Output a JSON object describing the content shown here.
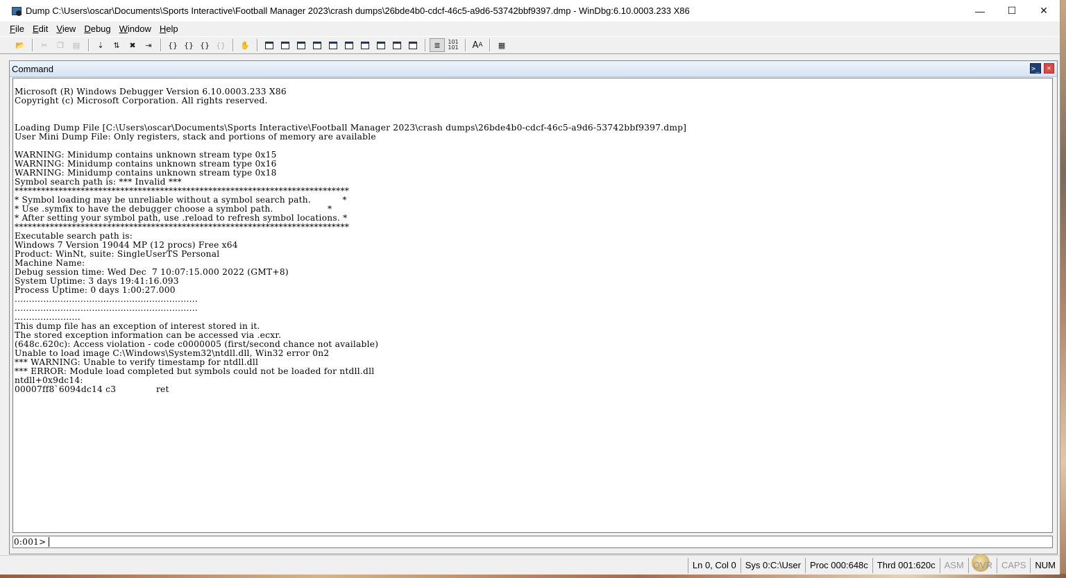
{
  "window": {
    "title": "Dump C:\\Users\\oscar\\Documents\\Sports Interactive\\Football Manager 2023\\crash dumps\\26bde4b0-cdcf-46c5-a9d6-53742bbf9397.dmp - WinDbg:6.10.0003.233 X86",
    "controls": {
      "minimize": "—",
      "maximize": "☐",
      "close": "✕"
    }
  },
  "menu": [
    {
      "label": "File",
      "key": "F",
      "rest": "ile"
    },
    {
      "label": "Edit",
      "key": "E",
      "rest": "dit"
    },
    {
      "label": "View",
      "key": "V",
      "rest": "iew"
    },
    {
      "label": "Debug",
      "key": "D",
      "rest": "ebug"
    },
    {
      "label": "Window",
      "key": "W",
      "rest": "indow"
    },
    {
      "label": "Help",
      "key": "H",
      "rest": "elp"
    }
  ],
  "toolbar_icons": [
    "open-icon",
    "cut-icon",
    "copy-icon",
    "paste-icon",
    "go-icon",
    "restart-icon",
    "stop-debugging-icon",
    "detach-icon",
    "step-into-icon",
    "step-over-icon",
    "step-out-icon",
    "run-to-cursor-icon",
    "break-icon",
    "command-window-icon",
    "watch-window-icon",
    "locals-window-icon",
    "registers-window-icon",
    "memory-window-icon",
    "call-stack-icon",
    "disassembly-window-icon",
    "scratch-pad-icon",
    "processes-threads-icon",
    "source-mode-icon",
    "hex-display-icon",
    "font-icon",
    "options-icon"
  ],
  "command": {
    "title": "Command",
    "prompt_button": ">_",
    "close_button": "×",
    "output": "Microsoft (R) Windows Debugger Version 6.10.0003.233 X86\nCopyright (c) Microsoft Corporation. All rights reserved.\n\n\nLoading Dump File [C:\\Users\\oscar\\Documents\\Sports Interactive\\Football Manager 2023\\crash dumps\\26bde4b0-cdcf-46c5-a9d6-53742bbf9397.dmp]\nUser Mini Dump File: Only registers, stack and portions of memory are available\n\nWARNING: Minidump contains unknown stream type 0x15\nWARNING: Minidump contains unknown stream type 0x16\nWARNING: Minidump contains unknown stream type 0x18\nSymbol search path is: *** Invalid ***\n****************************************************************************\n* Symbol loading may be unreliable without a symbol search path.           *\n* Use .symfix to have the debugger choose a symbol path.                   *\n* After setting your symbol path, use .reload to refresh symbol locations. *\n****************************************************************************\nExecutable search path is:\nWindows 7 Version 19044 MP (12 procs) Free x64\nProduct: WinNt, suite: SingleUserTS Personal\nMachine Name:\nDebug session time: Wed Dec  7 10:07:15.000 2022 (GMT+8)\nSystem Uptime: 3 days 19:41:16.093\nProcess Uptime: 0 days 1:00:27.000\n................................................................\n................................................................\n.......................\nThis dump file has an exception of interest stored in it.\nThe stored exception information can be accessed via .ecxr.\n(648c.620c): Access violation - code c0000005 (first/second chance not available)\nUnable to load image C:\\Windows\\System32\\ntdll.dll, Win32 error 0n2\n*** WARNING: Unable to verify timestamp for ntdll.dll\n*** ERROR: Module load completed but symbols could not be loaded for ntdll.dll\nntdll+0x9dc14:\n00007ff8`6094dc14 c3              ret",
    "prompt": "0:001>",
    "input_value": ""
  },
  "status": {
    "position": "Ln 0, Col 0",
    "sys": "Sys 0:C:\\User",
    "proc": "Proc 000:648c",
    "thrd": "Thrd 001:620c",
    "asm": "ASM",
    "ovr": "OVR",
    "caps": "CAPS",
    "num": "NUM"
  }
}
